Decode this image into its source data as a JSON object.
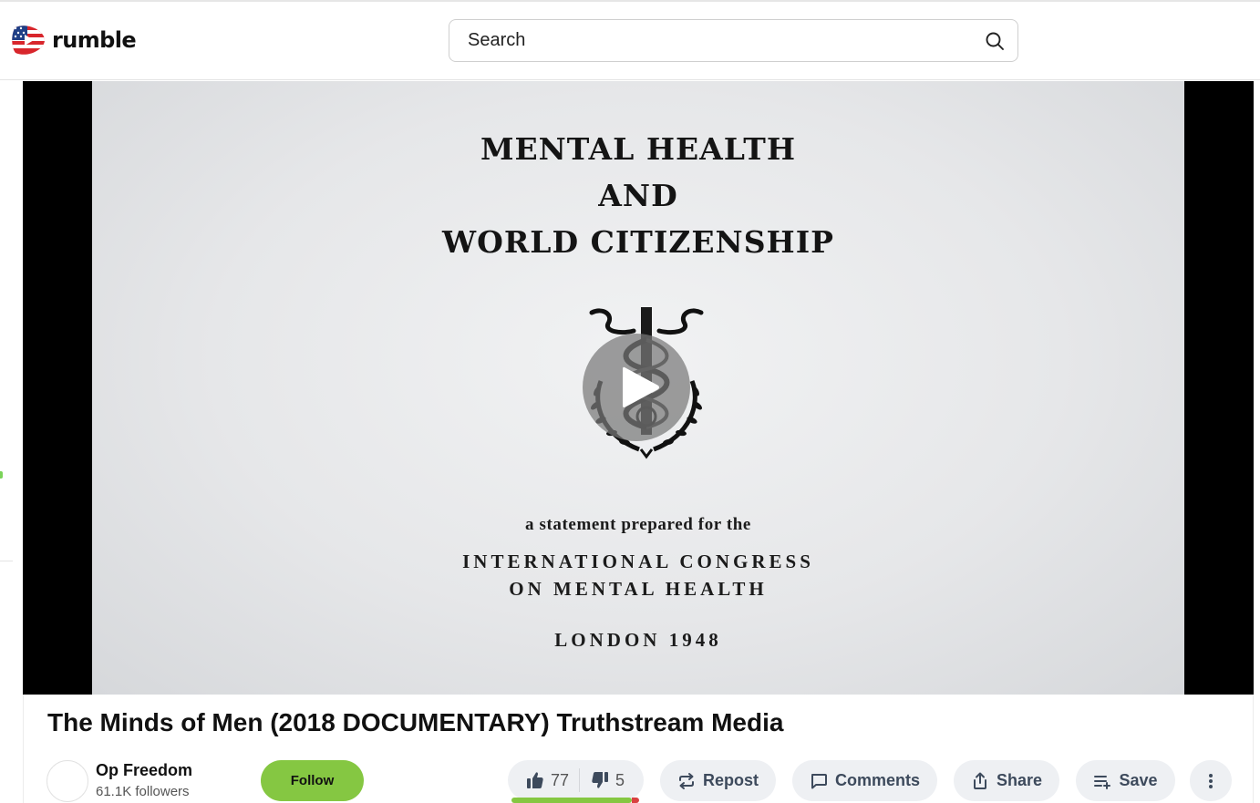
{
  "header": {
    "logo_text": "rumble",
    "search_placeholder": "Search"
  },
  "video": {
    "frame_text": {
      "line1": "MENTAL HEALTH",
      "line2": "AND",
      "line3": "WORLD CITIZENSHIP",
      "statement": "a statement prepared for the",
      "org_line1": "INTERNATIONAL CONGRESS",
      "org_line2": "ON MENTAL HEALTH",
      "place_year": "LONDON 1948"
    },
    "title": "The Minds of Men (2018 DOCUMENTARY) Truthstream Media"
  },
  "channel": {
    "name": "Op Freedom",
    "followers": "61.1K followers",
    "follow_label": "Follow"
  },
  "actions": {
    "likes": "77",
    "dislikes": "5",
    "like_fraction": 0.94,
    "repost_label": "Repost",
    "comments_label": "Comments",
    "share_label": "Share",
    "save_label": "Save"
  },
  "colors": {
    "accent_green": "#85c742",
    "button_bg": "#eef0f3",
    "button_text": "#3d4a5c"
  }
}
